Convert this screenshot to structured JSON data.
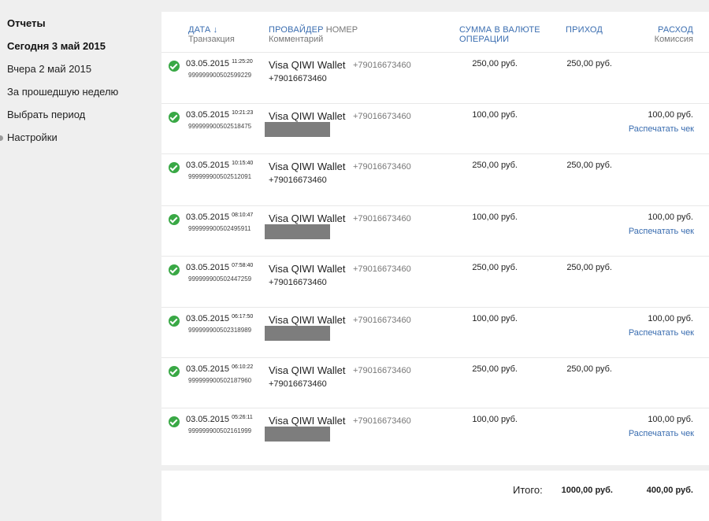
{
  "sidebar": {
    "title": "Отчеты",
    "items": [
      {
        "label": "Сегодня 3 май 2015",
        "active": true
      },
      {
        "label": "Вчера 2 май 2015",
        "active": false
      },
      {
        "label": "За прошедшую неделю",
        "active": false
      },
      {
        "label": "Выбрать период",
        "active": false
      },
      {
        "label": "Настройки",
        "active": false
      }
    ]
  },
  "table": {
    "headers": {
      "date": "Дата ↓",
      "date_sub": "Транзакция",
      "provider": "Провайдер",
      "provider_num": "Номер",
      "provider_sub": "Комментарий",
      "sum_line1": "Сумма в валюте",
      "sum_line2": "операции",
      "income": "Приход",
      "expense": "Расход",
      "expense_sub": "Комиссия"
    },
    "rows": [
      {
        "date": "03.05.2015",
        "time": "11:25:20",
        "txid": "999999900502599229",
        "provider": "Visa QIWI Wallet",
        "number": "+79016673460",
        "comment": "+79016673460",
        "sum": "250,00 руб.",
        "income": "250,00 руб.",
        "expense": "",
        "print": ""
      },
      {
        "date": "03.05.2015",
        "time": "10:21:23",
        "txid": "999999900502518475",
        "provider": "Visa QIWI Wallet",
        "number": "+79016673460",
        "comment": "",
        "sum": "100,00 руб.",
        "income": "",
        "expense": "100,00 руб.",
        "print": "Распечатать чек"
      },
      {
        "date": "03.05.2015",
        "time": "10:15:40",
        "txid": "999999900502512091",
        "provider": "Visa QIWI Wallet",
        "number": "+79016673460",
        "comment": "+79016673460",
        "sum": "250,00 руб.",
        "income": "250,00 руб.",
        "expense": "",
        "print": ""
      },
      {
        "date": "03.05.2015",
        "time": "08:10:47",
        "txid": "999999900502495911",
        "provider": "Visa QIWI Wallet",
        "number": "+79016673460",
        "comment": "",
        "sum": "100,00 руб.",
        "income": "",
        "expense": "100,00 руб.",
        "print": "Распечатать чек"
      },
      {
        "date": "03.05.2015",
        "time": "07:58:40",
        "txid": "999999900502447259",
        "provider": "Visa QIWI Wallet",
        "number": "+79016673460",
        "comment": "+79016673460",
        "sum": "250,00 руб.",
        "income": "250,00 руб.",
        "expense": "",
        "print": ""
      },
      {
        "date": "03.05.2015",
        "time": "06:17:50",
        "txid": "999999900502318989",
        "provider": "Visa QIWI Wallet",
        "number": "+79016673460",
        "comment": "",
        "sum": "100,00 руб.",
        "income": "",
        "expense": "100,00 руб.",
        "print": "Распечатать чек"
      },
      {
        "date": "03.05.2015",
        "time": "06:10:22",
        "txid": "999999900502187960",
        "provider": "Visa QIWI Wallet",
        "number": "+79016673460",
        "comment": "+79016673460",
        "sum": "250,00 руб.",
        "income": "250,00 руб.",
        "expense": "",
        "print": ""
      },
      {
        "date": "03.05.2015",
        "time": "05:26:11",
        "txid": "999999900502161999",
        "provider": "Visa QIWI Wallet",
        "number": "+79016673460",
        "comment": "",
        "sum": "100,00 руб.",
        "income": "",
        "expense": "100,00 руб.",
        "print": "Распечатать чек"
      }
    ]
  },
  "totals": {
    "label": "Итого:",
    "income": "1000,00 руб.",
    "expense": "400,00 руб."
  },
  "colors": {
    "link": "#3a6db0",
    "success": "#39a845",
    "redaction": "#7d7d7d"
  }
}
